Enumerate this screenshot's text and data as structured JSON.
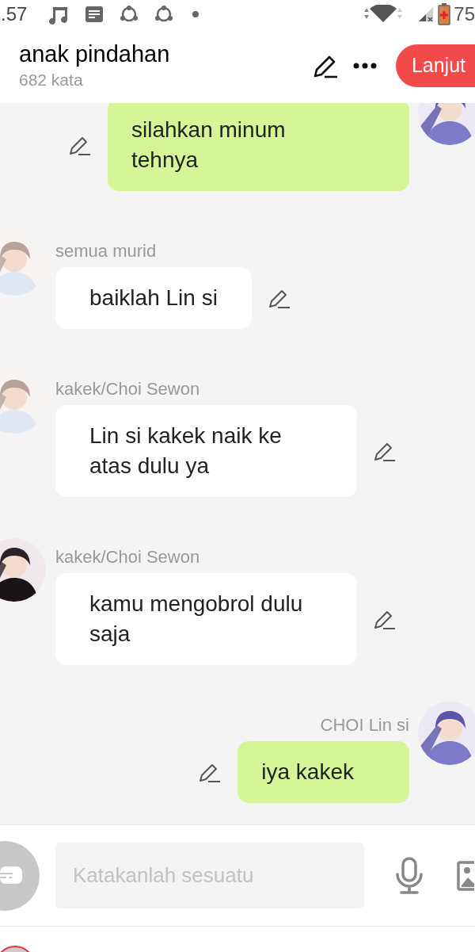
{
  "status_bar": {
    "time": ".57",
    "battery": "75"
  },
  "header": {
    "title": "anak pindahan",
    "subtitle": "682 kata",
    "button": "Lanjut"
  },
  "messages": [
    {
      "kind": "outgoing",
      "text": "silahkan minum tehnya"
    },
    {
      "kind": "incoming",
      "sender": "semua murid",
      "text": "baiklah Lin si"
    },
    {
      "kind": "incoming",
      "sender": "kakek/Choi Sewon",
      "text": "Lin si kakek naik ke atas dulu ya"
    },
    {
      "kind": "incoming",
      "sender": "kakek/Choi Sewon",
      "text": "kamu mengobrol dulu saja"
    },
    {
      "kind": "outgoing",
      "sender": "CHOI Lin si",
      "text": "iya kakek"
    }
  ],
  "composer": {
    "placeholder": "Katakanlah sesuatu"
  }
}
